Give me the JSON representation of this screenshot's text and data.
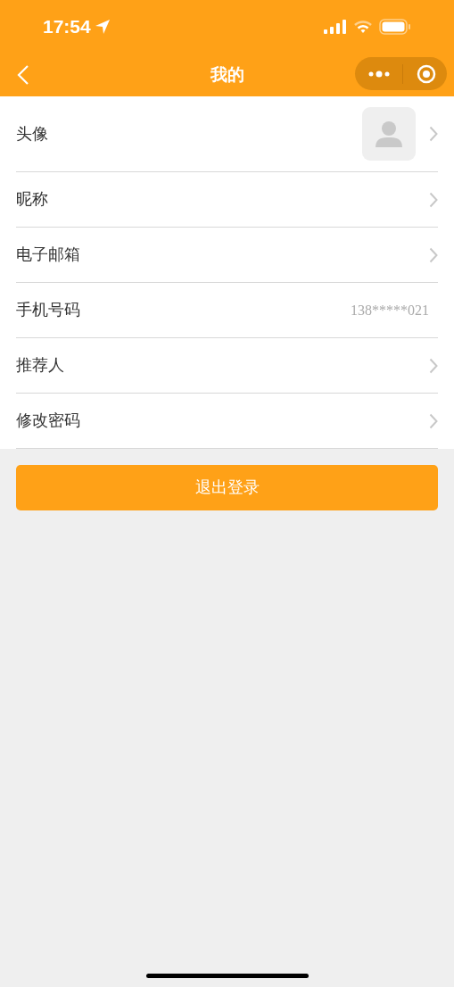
{
  "status_bar": {
    "time": "17:54"
  },
  "nav": {
    "title": "我的"
  },
  "rows": [
    {
      "kind": "avatar",
      "label": "头像"
    },
    {
      "kind": "link",
      "label": "昵称"
    },
    {
      "kind": "link",
      "label": "电子邮箱"
    },
    {
      "kind": "value",
      "label": "手机号码",
      "value": "138*****021"
    },
    {
      "kind": "link",
      "label": "推荐人"
    },
    {
      "kind": "link",
      "label": "修改密码"
    }
  ],
  "logout_button": "退出登录"
}
